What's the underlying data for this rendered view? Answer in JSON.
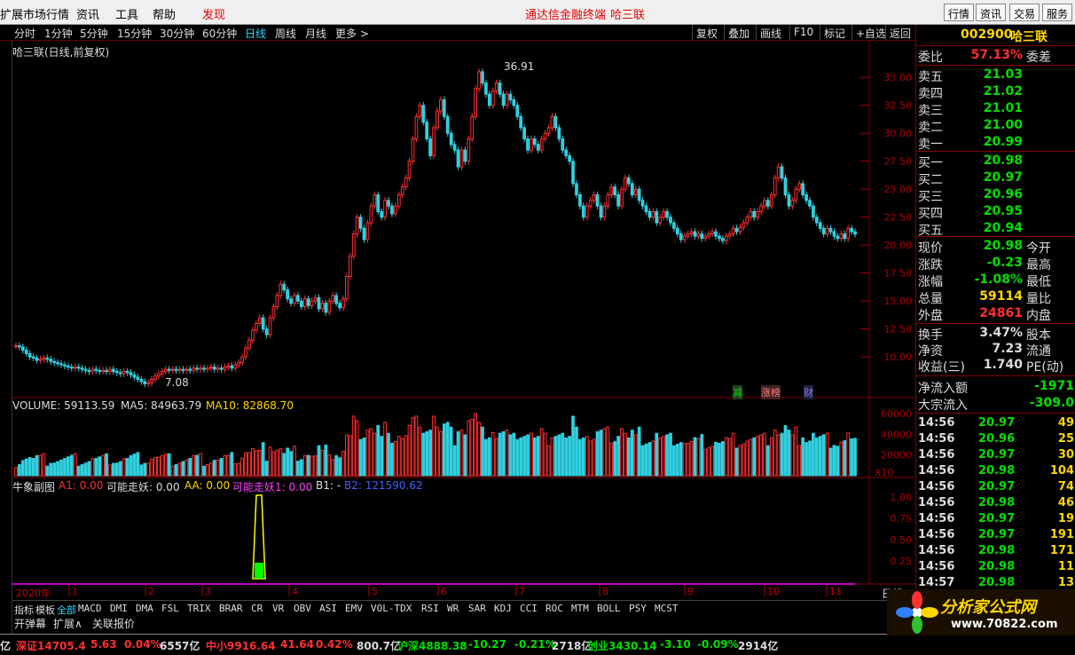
{
  "menu": {
    "items": [
      "扩展市场行情",
      "资讯",
      "工具",
      "帮助",
      "发现"
    ],
    "center_title": "通达信金融终端",
    "center_stock": "哈三联",
    "right_buttons": [
      "行情",
      "资讯",
      "交易",
      "服务"
    ]
  },
  "periods": {
    "items": [
      "分时",
      "1分钟",
      "5分钟",
      "15分钟",
      "30分钟",
      "60分钟",
      "日线",
      "周线",
      "月线",
      "更多 >"
    ],
    "active": "日线",
    "tools": [
      "复权",
      "叠加",
      "画线",
      "F10",
      "标记",
      "+自选",
      "返回"
    ]
  },
  "chart_title": "哈三联(日线,前复权)",
  "price_axis": [
    "35.00",
    "32.50",
    "30.00",
    "27.50",
    "25.00",
    "22.50",
    "20.00",
    "17.50",
    "15.00",
    "12.50",
    "10.00"
  ],
  "high_label": "36.91",
  "low_label": "7.08",
  "markers": {
    "jian": "减",
    "zhangbang": "涨榜",
    "cai": "财"
  },
  "volume": {
    "label": "VOLUME: 59113.59",
    "ma5": "MA5: 84963.79",
    "ma10": "MA10: 82868.70",
    "axis": [
      "60000",
      "40000",
      "20000"
    ],
    "unit": "X10"
  },
  "sub": {
    "name": "牛象副图",
    "a1": "A1: 0.00",
    "kenengzouyao": "可能走妖: 0.00",
    "aa": "AA: 0.00",
    "kenengzouyao1": "可能走妖1: 0.00",
    "b1": "B1: -",
    "b2": "B2: 121590.62",
    "axis": [
      "1.00",
      "0.75",
      "0.50",
      "0.25"
    ]
  },
  "time_axis": {
    "year": "2020年",
    "months": [
      "1",
      "2",
      "3",
      "4",
      "5",
      "6",
      "7",
      "8",
      "9",
      "10",
      "11"
    ],
    "period_tag": "日线"
  },
  "indicators": [
    "指标",
    "模板",
    "全部",
    "MACD",
    "DMI",
    "DMA",
    "FSL",
    "TRIX",
    "BRAR",
    "CR",
    "VR",
    "OBV",
    "ASI",
    "EMV",
    "VOL-TDX",
    "RSI",
    "WR",
    "SAR",
    "KDJ",
    "CCI",
    "ROC",
    "MTM",
    "BOLL",
    "PSY",
    "MCST"
  ],
  "indicator_active": "全部",
  "popups": [
    "开弹幕",
    "扩展∧",
    "关联报价"
  ],
  "quote": {
    "code": "002900",
    "name": "哈三联",
    "weibi_label": "委比",
    "weibi": "57.13%",
    "weicha_label": "委差",
    "asks": [
      {
        "label": "卖五",
        "price": "21.03"
      },
      {
        "label": "卖四",
        "price": "21.02"
      },
      {
        "label": "卖三",
        "price": "21.01"
      },
      {
        "label": "卖二",
        "price": "21.00"
      },
      {
        "label": "卖一",
        "price": "20.99"
      }
    ],
    "bids": [
      {
        "label": "买一",
        "price": "20.98"
      },
      {
        "label": "买二",
        "price": "20.97"
      },
      {
        "label": "买三",
        "price": "20.96"
      },
      {
        "label": "买四",
        "price": "20.95"
      },
      {
        "label": "买五",
        "price": "20.94"
      }
    ],
    "stats": [
      {
        "label": "现价",
        "value": "20.98",
        "label2": "今开",
        "color": "#00e000"
      },
      {
        "label": "涨跌",
        "value": "-0.23",
        "label2": "最高",
        "color": "#00e000"
      },
      {
        "label": "涨幅",
        "value": "-1.08%",
        "label2": "最低",
        "color": "#00e000"
      },
      {
        "label": "总量",
        "value": "59114",
        "label2": "量比",
        "color": "#ffd700"
      },
      {
        "label": "外盘",
        "value": "24861",
        "label2": "内盘",
        "color": "#ff3030"
      }
    ],
    "stats2": [
      {
        "label": "换手",
        "value": "3.47%",
        "label2": "股本"
      },
      {
        "label": "净资",
        "value": "7.23",
        "label2": "流通"
      },
      {
        "label": "收益(三)",
        "value": "1.740",
        "label2": "PE(动)"
      }
    ],
    "flow": [
      {
        "label": "净流入额",
        "value": "-1971"
      },
      {
        "label": "大宗流入",
        "value": "-309.0"
      }
    ],
    "ticks": [
      {
        "t": "14:56",
        "p": "20.97",
        "v": "49"
      },
      {
        "t": "14:56",
        "p": "20.96",
        "v": "25"
      },
      {
        "t": "14:56",
        "p": "20.97",
        "v": "30"
      },
      {
        "t": "14:56",
        "p": "20.98",
        "v": "104"
      },
      {
        "t": "14:56",
        "p": "20.97",
        "v": "74"
      },
      {
        "t": "14:56",
        "p": "20.98",
        "v": "46"
      },
      {
        "t": "14:56",
        "p": "20.97",
        "v": "19"
      },
      {
        "t": "14:56",
        "p": "20.97",
        "v": "191"
      },
      {
        "t": "14:56",
        "p": "20.98",
        "v": "171"
      },
      {
        "t": "14:56",
        "p": "20.98",
        "v": "11"
      },
      {
        "t": "14:57",
        "p": "20.98",
        "v": "13"
      }
    ]
  },
  "status": {
    "items": [
      {
        "text": "亿",
        "color": "#ddd"
      },
      {
        "text": "深证14705.4",
        "color": "#ff3030"
      },
      {
        "text": "5.63",
        "color": "#ff3030"
      },
      {
        "text": "0.04%",
        "color": "#ff3030"
      },
      {
        "text": "6557亿",
        "color": "#ddd"
      },
      {
        "text": "中小9916.64",
        "color": "#ff3030"
      },
      {
        "text": "41.64",
        "color": "#ff3030"
      },
      {
        "text": "0.42%",
        "color": "#ff3030"
      },
      {
        "text": "800.7亿",
        "color": "#ddd"
      },
      {
        "text": "沪深4888.38",
        "color": "#00e000"
      },
      {
        "text": "-10.27",
        "color": "#00e000"
      },
      {
        "text": "-0.21%",
        "color": "#00e000"
      },
      {
        "text": "2718亿",
        "color": "#ddd"
      },
      {
        "text": "创业3430.14",
        "color": "#00e000"
      },
      {
        "text": "-3.10",
        "color": "#00e000"
      },
      {
        "text": "-0.09%",
        "color": "#00e000"
      },
      {
        "text": "2914亿",
        "color": "#ddd"
      }
    ]
  },
  "logo": {
    "title": "分析家公式网",
    "url": "www.70822.com"
  },
  "chart_data": {
    "type": "candlestick",
    "title": "哈三联(日线,前复权)",
    "ylim": [
      7,
      37
    ],
    "high": 36.91,
    "low": 7.08,
    "closes": [
      11.0,
      10.9,
      10.6,
      10.3,
      10.0,
      9.9,
      9.7,
      9.8,
      9.9,
      9.8,
      9.6,
      9.5,
      9.4,
      9.3,
      9.2,
      9.1,
      9.0,
      9.1,
      9.0,
      8.9,
      8.8,
      8.7,
      8.9,
      8.8,
      8.7,
      8.8,
      8.7,
      8.9,
      8.7,
      8.6,
      8.5,
      8.7,
      8.6,
      8.4,
      8.2,
      8.0,
      7.8,
      7.6,
      7.7,
      8.0,
      8.3,
      8.5,
      8.7,
      8.9,
      8.8,
      8.9,
      8.8,
      8.9,
      8.8,
      8.9,
      8.8,
      9.0,
      8.9,
      9.0,
      8.9,
      9.0,
      9.1,
      8.9,
      9.0,
      8.9,
      9.1,
      9.2,
      9.0,
      9.3,
      9.5,
      10.0,
      10.8,
      11.5,
      12.4,
      13.0,
      13.5,
      12.5,
      12.0,
      13.5,
      14.5,
      15.5,
      16.5,
      16.0,
      15.2,
      14.8,
      15.5,
      15.0,
      14.5,
      15.2,
      14.6,
      15.0,
      15.3,
      14.3,
      14.8,
      14.0,
      15.0,
      15.5,
      14.8,
      14.4,
      15.2,
      17.2,
      19.0,
      21.0,
      22.5,
      21.5,
      20.5,
      22.0,
      23.5,
      24.5,
      23.0,
      22.5,
      24.0,
      23.5,
      22.8,
      23.5,
      24.5,
      25.2,
      26.0,
      27.5,
      29.5,
      31.5,
      32.5,
      31.0,
      29.5,
      28.0,
      30.5,
      32.0,
      33.0,
      31.5,
      30.0,
      29.0,
      28.5,
      27.0,
      28.5,
      27.5,
      29.5,
      31.5,
      34.0,
      35.5,
      34.5,
      33.5,
      32.5,
      33.8,
      34.5,
      33.5,
      32.5,
      33.5,
      33.0,
      32.5,
      31.5,
      30.5,
      29.5,
      28.5,
      29.5,
      29.0,
      28.5,
      29.5,
      30.0,
      30.5,
      31.5,
      30.5,
      29.5,
      28.5,
      28.0,
      27.5,
      25.5,
      24.5,
      23.5,
      22.5,
      23.5,
      24.0,
      24.5,
      23.5,
      22.5,
      23.5,
      24.5,
      25.2,
      24.5,
      23.5,
      25.0,
      26.0,
      25.5,
      24.5,
      25.0,
      24.0,
      23.5,
      23.0,
      22.5,
      23.0,
      22.0,
      22.5,
      23.0,
      22.5,
      22.0,
      21.5,
      21.0,
      20.5,
      20.8,
      21.0,
      21.2,
      20.8,
      21.0,
      20.6,
      20.8,
      21.0,
      21.2,
      20.8,
      20.6,
      20.4,
      20.8,
      21.0,
      21.5,
      21.2,
      21.6,
      22.0,
      22.5,
      23.0,
      22.5,
      23.0,
      23.5,
      24.0,
      23.5,
      24.5,
      26.0,
      27.0,
      26.0,
      24.5,
      23.5,
      24.0,
      25.0,
      25.5,
      24.5,
      24.0,
      23.5,
      22.5,
      22.0,
      21.5,
      21.0,
      21.5,
      21.2,
      20.8,
      20.6,
      21.0,
      20.6,
      21.5,
      21.2,
      20.98
    ]
  }
}
